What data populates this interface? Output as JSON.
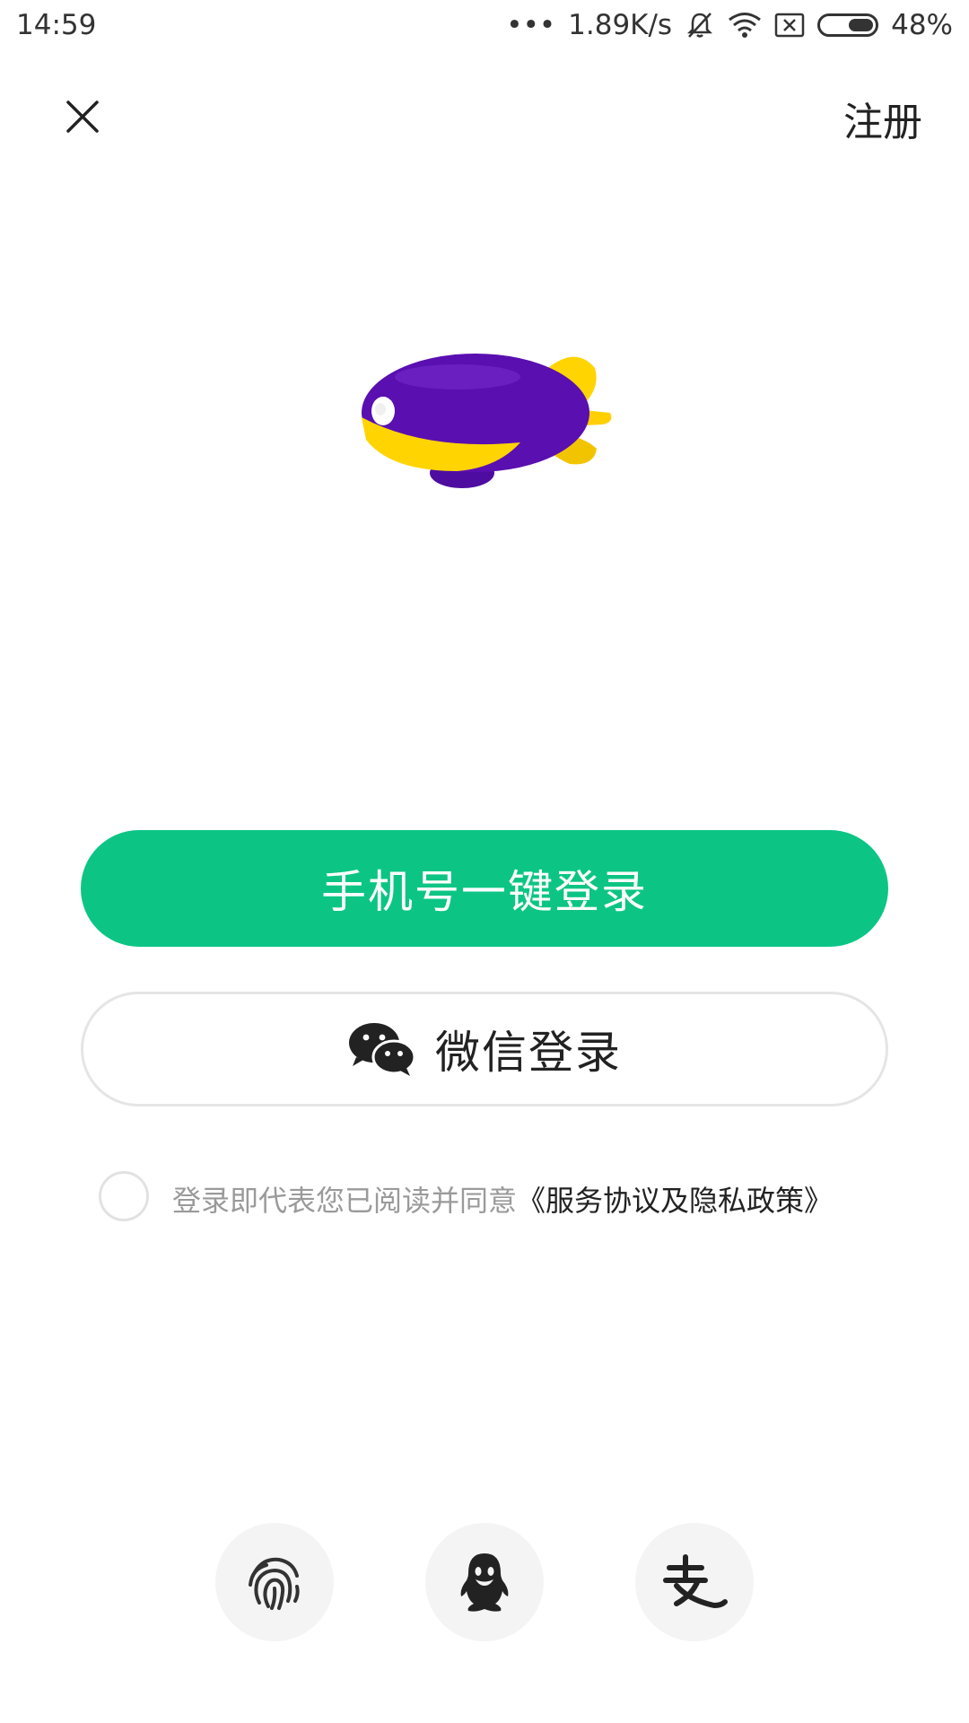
{
  "status_bar": {
    "time": "14:59",
    "dots": "•••",
    "network_speed": "1.89K/s",
    "battery_level": 0.48,
    "battery_text": "48%",
    "icons": [
      "mute-icon",
      "wifi-icon",
      "sim-off-icon",
      "battery-icon"
    ]
  },
  "header": {
    "close_icon": "close-icon",
    "register_label": "注册"
  },
  "mascot": {
    "icon": "blimp-mascot-icon",
    "colors": {
      "body": "#5a0fb0",
      "accent": "#ffd400"
    }
  },
  "actions": {
    "phone_login_label": "手机号一键登录",
    "wechat_login_label": "微信登录"
  },
  "agreement": {
    "text": "登录即代表您已阅读并同意",
    "link": "《服务协议及隐私政策》",
    "checked": false
  },
  "alt_login": [
    {
      "icon": "fingerprint-icon"
    },
    {
      "icon": "qq-icon"
    },
    {
      "icon": "alipay-icon"
    }
  ],
  "colors": {
    "primary": "#0cc585",
    "text_dark": "#222222",
    "text_muted": "#9a9a9a",
    "alt_bg": "#f4f4f4"
  }
}
